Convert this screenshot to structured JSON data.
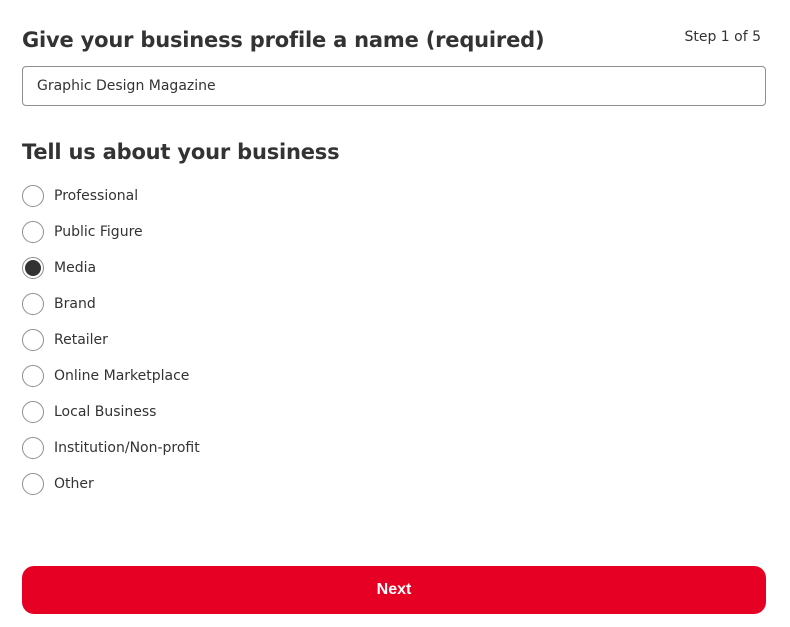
{
  "header": {
    "title": "Give your business profile a name (required)",
    "step": "Step 1 of 5"
  },
  "name_field": {
    "value": "Graphic Design Magazine"
  },
  "business_type": {
    "title": "Tell us about your business",
    "selected": "Media",
    "options": [
      {
        "label": "Professional",
        "checked": false
      },
      {
        "label": "Public Figure",
        "checked": false
      },
      {
        "label": "Media",
        "checked": true
      },
      {
        "label": "Brand",
        "checked": false
      },
      {
        "label": "Retailer",
        "checked": false
      },
      {
        "label": "Online Marketplace",
        "checked": false
      },
      {
        "label": "Local Business",
        "checked": false
      },
      {
        "label": "Institution/Non-profit",
        "checked": false
      },
      {
        "label": "Other",
        "checked": false
      }
    ]
  },
  "actions": {
    "next_label": "Next"
  },
  "colors": {
    "accent": "#e60023",
    "text": "#333333"
  }
}
